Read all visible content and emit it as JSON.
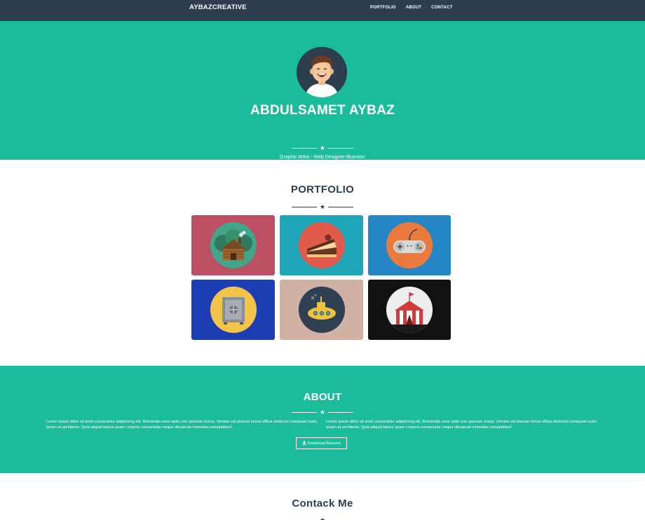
{
  "nav": {
    "brand": "AYBAZCREATIVE",
    "links": [
      "PORTFOLIO",
      "ABOUT",
      "CONTACT"
    ]
  },
  "hero": {
    "name": "ABDULSAMET AYBAZ",
    "subtitle": "Graphic Artist - Web Designer-Illusrator"
  },
  "portfolio": {
    "title": "PORTFOLIO",
    "items": [
      {
        "icon": "cabin-icon",
        "bg": "#bd4f62",
        "circle": "#44a489"
      },
      {
        "icon": "cake-icon",
        "bg": "#1ea6b8",
        "circle": "#e25a4b"
      },
      {
        "icon": "game-controller-icon",
        "bg": "#2586c6",
        "circle": "#ea7a3d"
      },
      {
        "icon": "safe-icon",
        "bg": "#1c3db3",
        "circle": "#f2c54a"
      },
      {
        "icon": "submarine-icon",
        "bg": "#cfb2a4",
        "circle": "#2f4052"
      },
      {
        "icon": "circus-tent-icon",
        "bg": "#111111",
        "circle": "#eeeeee"
      }
    ]
  },
  "about": {
    "title": "ABOUT",
    "col1": "Lorem ipsum dolor sit amet consectetur adipisicing elit. Reiciendis esse optio rem aperiam minus. Veniam est placeat minus officia distinctio numquam iusto, ipsam at architecto. Quia aliquid labore quam corporis consectetur neque obcaecati molestias voluptatibus!",
    "col2": "Lorem ipsum dolor sit amet consectetur adipisicing elit. Reiciendis esse optio rem aperiam minus. Veniam est placeat minus officia distinctio numquam iusto, ipsam at architecto. Quia aliquid labore quam corporis consectetur neque obcaecati molestias voluptatibus!",
    "button": "Download Resume"
  },
  "contact": {
    "title": "Contack Me"
  },
  "colors": {
    "navy": "#2c3e50",
    "teal": "#1abc9c"
  }
}
